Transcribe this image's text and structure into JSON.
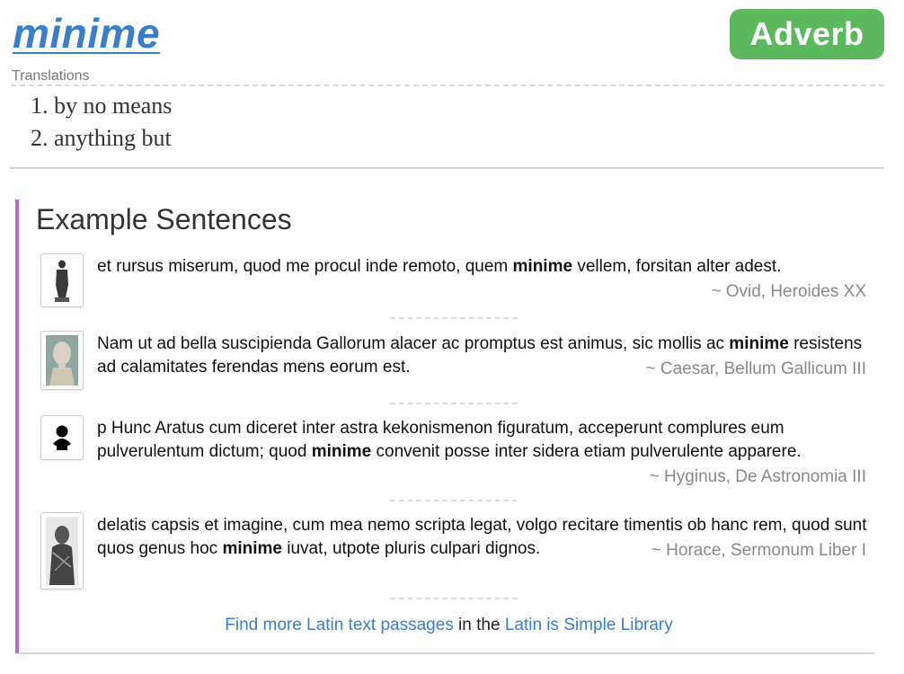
{
  "entry": {
    "headword": "minime",
    "part_of_speech": "Adverb",
    "translations_label": "Translations",
    "translations": [
      {
        "num": "1.",
        "text": "by no means"
      },
      {
        "num": "2.",
        "text": "anything but"
      }
    ]
  },
  "examples": {
    "title": "Example Sentences",
    "items": [
      {
        "before": "et rursus miserum, quod me procul inde remoto, quem ",
        "highlight": "minime",
        "after": " vellem, forsitan alter adest.",
        "citation": "~ Ovid, Heroides XX",
        "thumb_icon": "statue-icon"
      },
      {
        "before": "Nam ut ad bella suscipienda Gallorum alacer ac promptus est animus, sic mollis ac ",
        "highlight": "minime",
        "after": " resistens ad calamitates ferendas mens eorum est.",
        "citation": "~ Caesar, Bellum Gallicum III",
        "thumb_icon": "bust-portrait-icon"
      },
      {
        "before": "p Hunc Aratus cum diceret inter astra kekonismenon figuratum, acceperunt complures eum pulverulentum dictum; quod ",
        "highlight": "minime",
        "after": " convenit posse inter sidera etiam pulverulente apparere.",
        "citation": "~ Hyginus, De Astronomia III",
        "thumb_icon": "bust-silhouette-icon"
      },
      {
        "before": "delatis capsis et imagine, cum mea nemo scripta legat, volgo recitare timentis ob hanc rem, quod sunt quos genus hoc ",
        "highlight": "minime",
        "after": " iuvat, utpote pluris culpari dignos.",
        "citation": "~ Horace, Sermonum Liber I",
        "thumb_icon": "engraving-portrait-icon"
      }
    ],
    "footer": {
      "link1": "Find more Latin text passages",
      "middle": " in the ",
      "link2": "Latin is Simple Library"
    }
  }
}
